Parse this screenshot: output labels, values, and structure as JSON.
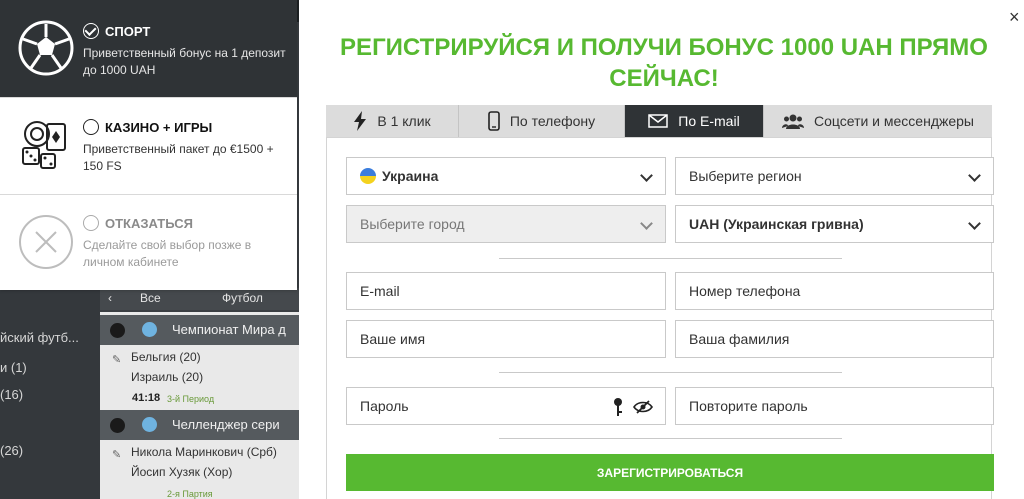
{
  "background": {
    "left_items": [
      "йский футб...",
      "и (1)",
      "(16)",
      "(26)"
    ],
    "filter": {
      "all_label": "Все",
      "football_label": "Футбол"
    },
    "events": [
      {
        "league": "Чемпионат Мира д",
        "team1": "Бельгия (20)",
        "team2": "Израиль (20)",
        "time": "41:18",
        "period": "3-й Период"
      },
      {
        "league": "Челленджер сери",
        "team1": "Никола Маринкович (Срб)",
        "team2": "Йосип Хузяк (Хор)",
        "time": "",
        "period": "2-я Партия"
      }
    ]
  },
  "chooser": {
    "options": [
      {
        "title": "СПОРТ",
        "desc": "Приветственный бонус на 1 депозит до 1000 UAH",
        "selected": true,
        "icon": "soccer-ball-icon"
      },
      {
        "title": "КАЗИНО + ИГРЫ",
        "desc": "Приветственный пакет до €1500 + 150 FS",
        "selected": false,
        "icon": "casino-chips-icon"
      },
      {
        "title": "ОТКАЗАТЬСЯ",
        "desc": "Сделайте свой выбор позже в личном кабинете",
        "selected": false,
        "icon": "cancel-circle-icon"
      }
    ]
  },
  "modal": {
    "close_label": "×",
    "headline": "РЕГИСТРИРУЙСЯ И ПОЛУЧИ БОНУС 1000 UAH ПРЯМО СЕЙЧАС!",
    "tabs": [
      {
        "label": "В 1 клик",
        "icon": "lightning-icon",
        "active": false
      },
      {
        "label": "По телефону",
        "icon": "phone-icon",
        "active": false
      },
      {
        "label": "По E-mail",
        "icon": "envelope-icon",
        "active": true
      },
      {
        "label": "Соцсети и мессенджеры",
        "icon": "users-icon",
        "active": false
      }
    ],
    "form": {
      "country": "Украина",
      "region_placeholder": "Выберите регион",
      "city_placeholder": "Выберите город",
      "currency": "UAH (Украинская гривна)",
      "email_placeholder": "E-mail",
      "phone_placeholder": "Номер телефона",
      "name_placeholder": "Ваше имя",
      "surname_placeholder": "Ваша фамилия",
      "password_placeholder": "Пароль",
      "password_repeat_placeholder": "Повторите пароль",
      "submit_label": "ЗАРЕГИСТРИРОВАТЬСЯ"
    }
  },
  "colors": {
    "accent_green": "#57b931",
    "dark": "#2f3336"
  }
}
